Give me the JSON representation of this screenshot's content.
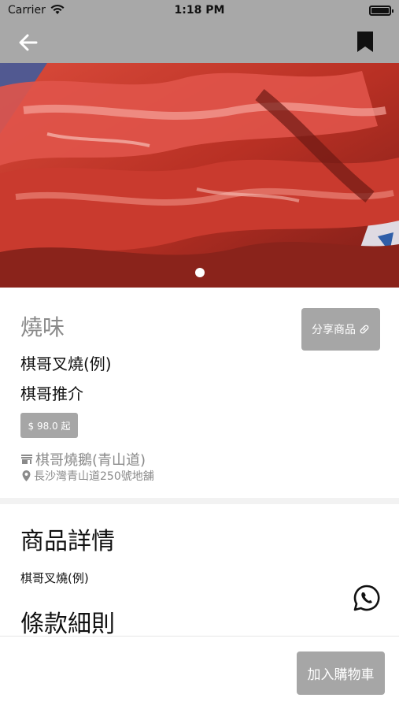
{
  "status_bar": {
    "carrier": "Carrier",
    "time": "1:18 PM"
  },
  "nav": {
    "back_icon": "back-arrow-icon",
    "bookmark_icon": "bookmark-icon"
  },
  "hero": {
    "carousel_pages": 1,
    "current_page": 1
  },
  "product": {
    "category": "燒味",
    "name": "棋哥叉燒(例)",
    "recommend": "棋哥推介",
    "price": "$ 98.0 起",
    "shop": "棋哥燒鵝(青山道)",
    "address": "長沙灣青山道250號地舖"
  },
  "share": {
    "label": "分享商品"
  },
  "details": {
    "title": "商品詳情",
    "text": "棋哥叉燒(例)",
    "terms_title": "條款細則"
  },
  "bottom": {
    "cart_label": "加入購物車"
  },
  "colors": {
    "bar_gray": "#a8a8a8",
    "button_gray": "#a6a6a6",
    "muted_text": "#8a8a8a"
  }
}
